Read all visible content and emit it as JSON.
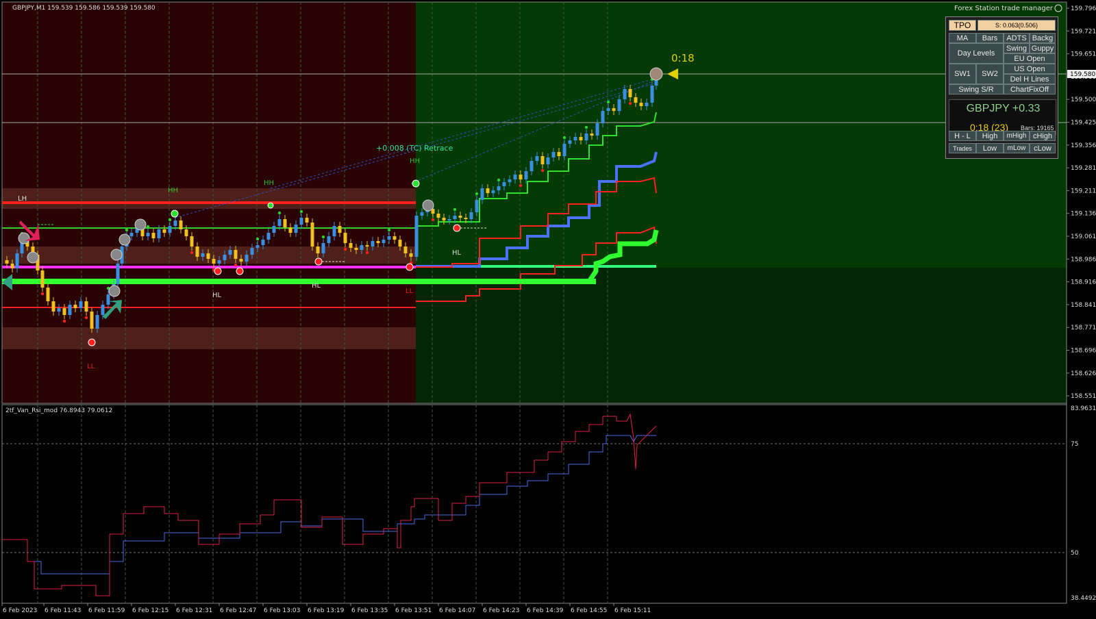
{
  "window": {
    "chart_title": "GBPJPY,M1  159.539 159.586 159.539 159.580",
    "trade_manager": "Forex Station trade manager",
    "countdown": "0:18"
  },
  "annotations": {
    "retrace": "+0.008 (TC) Retrace",
    "lh": "LH",
    "hh1": "HH",
    "hh2": "HH",
    "hh3": "HH",
    "hl1": "HL",
    "hl2": "HL",
    "hl3": "HL",
    "ll1": "LL",
    "ll2": "LL"
  },
  "price_axis": {
    "labels": [
      "159.796",
      "159.721",
      "159.651",
      "159.580",
      "159.500",
      "159.425",
      "159.356",
      "159.281",
      "159.211",
      "159.136",
      "159.061",
      "158.986",
      "158.916",
      "158.841",
      "158.771",
      "158.696",
      "158.626",
      "158.551"
    ],
    "current_price": "159.580"
  },
  "indicator": {
    "title": "2tf_Van_Rsi_mod 76.8943 79.0612",
    "axis_labels": [
      "83.9631",
      "75",
      "50",
      "38.4492"
    ],
    "series_fast_color": "#e0204a",
    "series_slow_color": "#4a6ae8"
  },
  "time_axis": {
    "labels": [
      "6 Feb 2023",
      "6 Feb 11:43",
      "6 Feb 11:59",
      "6 Feb 12:15",
      "6 Feb 12:31",
      "6 Feb 12:47",
      "6 Feb 13:03",
      "6 Feb 13:19",
      "6 Feb 13:35",
      "6 Feb 13:51",
      "6 Feb 14:07",
      "6 Feb 14:23",
      "6 Feb 14:39",
      "6 Feb 14:55",
      "6 Feb 15:11"
    ]
  },
  "panel": {
    "tpo": "TPO",
    "spread": "S: 0.063(0.506)",
    "ma": "MA",
    "bars": "Bars",
    "adts": "ADTS",
    "backg": "Backg",
    "day_levels": "Day Levels",
    "swing": "Swing",
    "guppy": "Guppy",
    "eu_open": "EU Open",
    "sw1": "SW1",
    "sw2": "SW2",
    "us_open": "US Open",
    "del_h_lines": "Del H Lines",
    "swing_sr": "Swing S/R",
    "chart_fix_off": "ChartFixOff",
    "symbol": "GBPJPY +0.33",
    "timer": "0:18 (23)",
    "bars_count": "Bars: 19165",
    "h_l": "H - L",
    "high": "High",
    "mhigh": "mHigh",
    "chigh": "cHigh",
    "trades": "Trades",
    "low": "Low",
    "mlow": "mLow",
    "clow": "cLow"
  },
  "colors": {
    "bear_background": "#2a0404",
    "bull_background": "#053a05",
    "bull_candle": "#3a8ee0",
    "bear_candle": "#f0c020",
    "resistance_line": "#ff2020",
    "support_green": "#30ff30",
    "magenta_line": "#ff30ff"
  }
}
